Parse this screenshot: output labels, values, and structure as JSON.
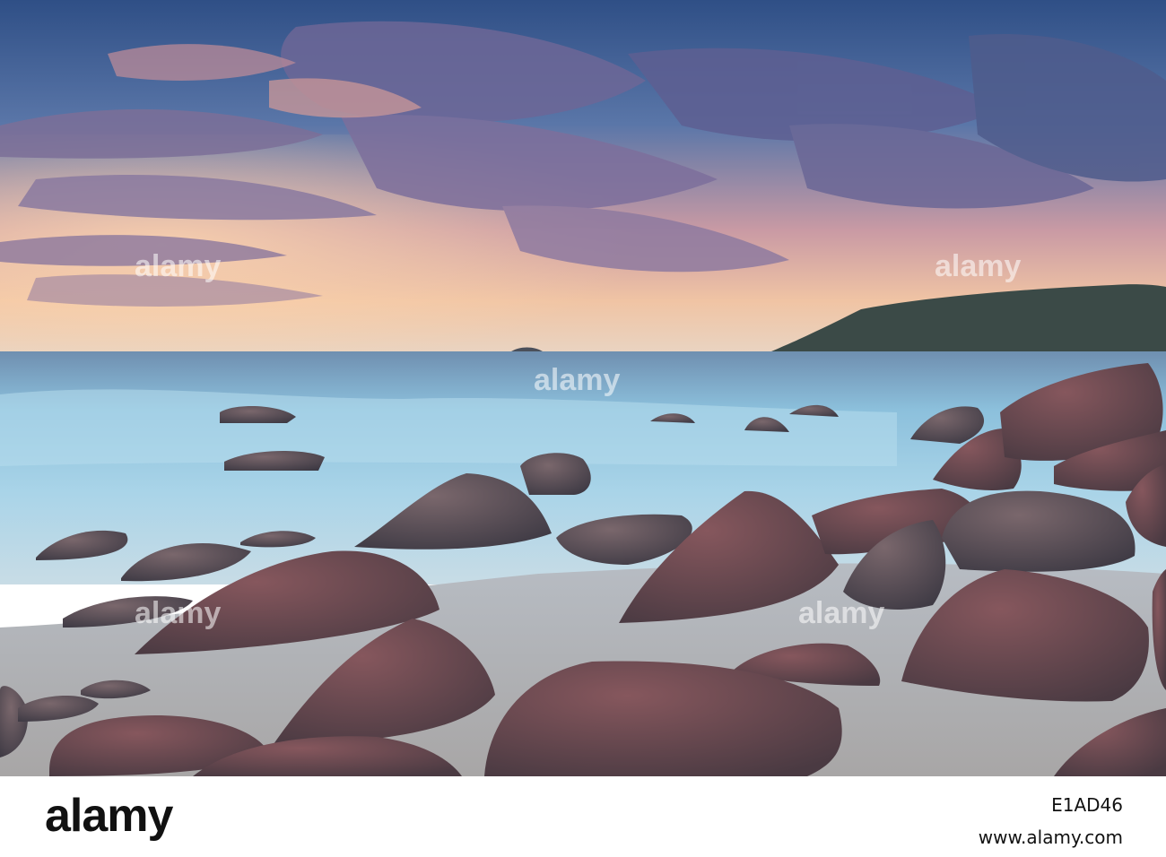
{
  "photo": {
    "scene": "sunset-rocky-beach",
    "colors": {
      "sky_top": "#3f5e93",
      "sky_glow": "#f1b38e",
      "sea": "#8fc3dc",
      "sand": "#b9bdc0",
      "rock": "#5e4f55"
    }
  },
  "watermark": {
    "text": "alamy"
  },
  "footer": {
    "logo": "alamy",
    "image_id": "E1AD46",
    "url": "www.alamy.com"
  }
}
